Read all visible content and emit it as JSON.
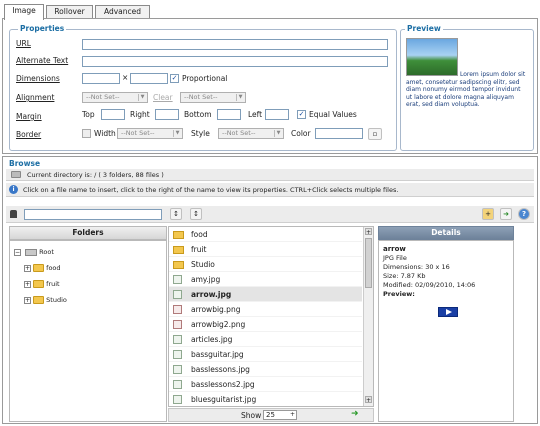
{
  "tabs": [
    {
      "label": "Image"
    },
    {
      "label": "Rollover"
    },
    {
      "label": "Advanced"
    }
  ],
  "properties": {
    "legend": "Properties",
    "url_label": "URL",
    "alt_label": "Alternate Text",
    "dimensions_label": "Dimensions",
    "times": "×",
    "proportional_label": "Proportional",
    "alignment_label": "Alignment",
    "alignment_value": "--Not Set--",
    "clear_label": "Clear",
    "clear_value": "--Not Set--",
    "margin_label": "Margin",
    "top_label": "Top",
    "right_label": "Right",
    "bottom_label": "Bottom",
    "left_label": "Left",
    "equal_values_label": "Equal Values",
    "border_label": "Border",
    "width_label": "Width",
    "width_value": "--Not Set--",
    "style_label": "Style",
    "style_value": "--Not Set--",
    "color_label": "Color"
  },
  "preview": {
    "legend": "Preview",
    "text": "Lorem ipsum dolor sit amet, consetetur sadipscing elitr, sed diam nonumy eirmod tempor invidunt ut labore et dolore magna aliquyam erat, sed diam voluptua."
  },
  "browse": {
    "legend": "Browse",
    "current_directory": "Current directory is: / ( 3 folders, 88 files )",
    "info": "Click on a file name to insert, click to the right of the name to view its properties. CTRL+Click selects multiple files.",
    "folders_header": "Folders",
    "details_header": "Details",
    "tree": [
      {
        "label": "Root"
      },
      {
        "label": "food"
      },
      {
        "label": "fruit"
      },
      {
        "label": "Studio"
      }
    ],
    "files": [
      {
        "name": "food",
        "kind": "folder"
      },
      {
        "name": "fruit",
        "kind": "folder"
      },
      {
        "name": "Studio",
        "kind": "folder"
      },
      {
        "name": "amy.jpg",
        "kind": "jpg"
      },
      {
        "name": "arrow.jpg",
        "kind": "jpg"
      },
      {
        "name": "arrowbig.png",
        "kind": "png"
      },
      {
        "name": "arrowbig2.png",
        "kind": "png"
      },
      {
        "name": "articles.jpg",
        "kind": "jpg"
      },
      {
        "name": "bassguitar.jpg",
        "kind": "jpg"
      },
      {
        "name": "basslessons.jpg",
        "kind": "jpg"
      },
      {
        "name": "basslessons2.jpg",
        "kind": "jpg"
      },
      {
        "name": "bluesguitarist.jpg",
        "kind": "jpg"
      }
    ],
    "show_label": "Show",
    "show_value": "25",
    "details": {
      "name": "arrow",
      "type": "JPG File",
      "dimensions": "Dimensions: 30 x 16",
      "size": "Size: 7.87 Kb",
      "modified": "Modified: 02/09/2010, 14:06",
      "preview_label": "Preview:"
    }
  },
  "colors": {
    "accent": "#1c6ea4",
    "header_dark": "#7a8ea6",
    "selected_row": "#e4e4e4"
  }
}
